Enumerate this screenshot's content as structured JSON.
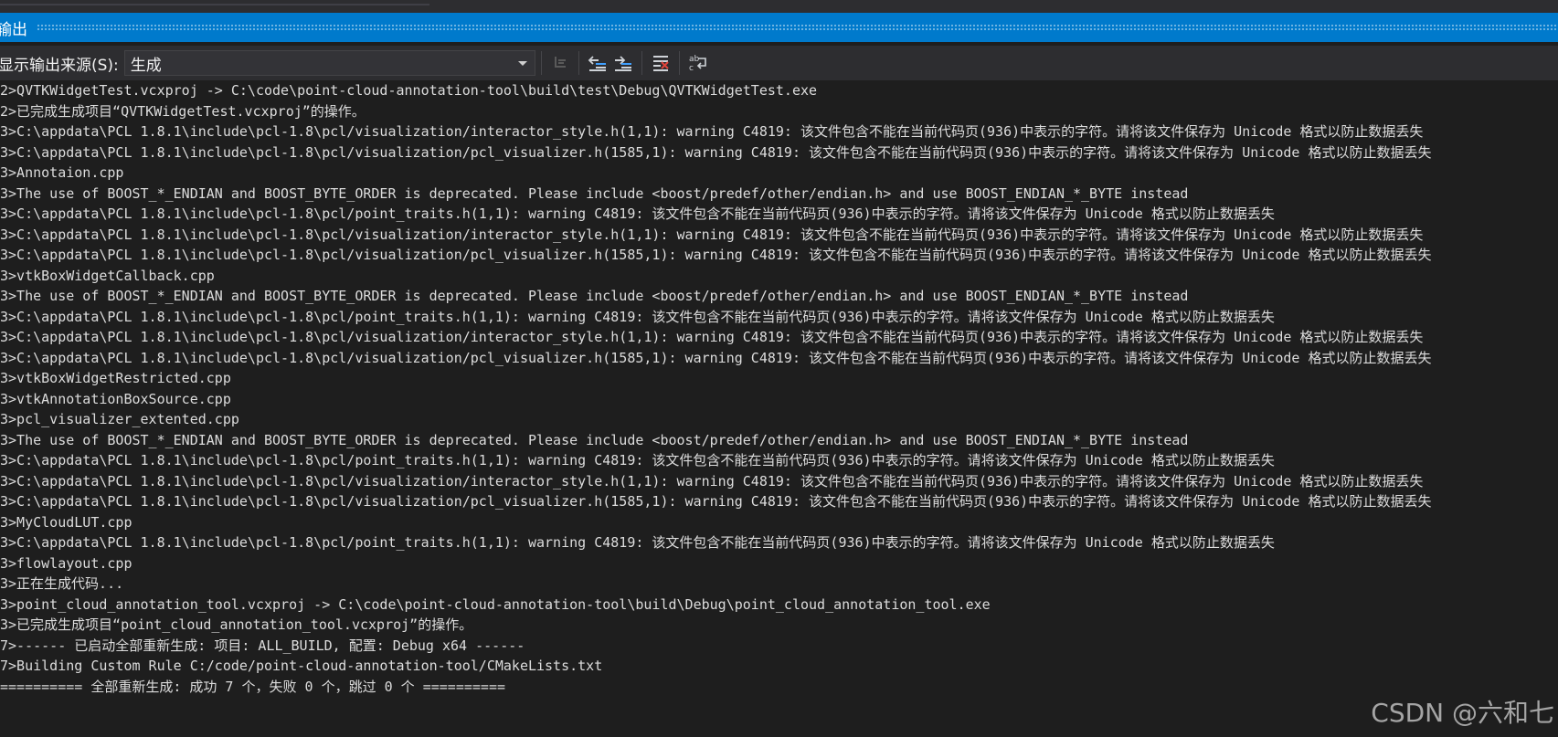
{
  "panel": {
    "title": "输出",
    "source_label": "显示输出来源(S):",
    "source_value": "生成"
  },
  "icons": {
    "find_message": "find-message-icon",
    "prev_message": "go-to-previous-message-icon",
    "next_message": "go-to-next-message-icon",
    "clear_all": "clear-all-icon",
    "word_wrap": "toggle-word-wrap-icon"
  },
  "colors": {
    "accent": "#007acc",
    "background": "#1e1e1e",
    "toolbar": "#2d2d30",
    "text": "#dcdcdc"
  },
  "output_lines": [
    "2>QVTKWidgetTest.vcxproj -> C:\\code\\point-cloud-annotation-tool\\build\\test\\Debug\\QVTKWidgetTest.exe",
    "2>已完成生成项目“QVTKWidgetTest.vcxproj”的操作。",
    "3>C:\\appdata\\PCL 1.8.1\\include\\pcl-1.8\\pcl/visualization/interactor_style.h(1,1): warning C4819: 该文件包含不能在当前代码页(936)中表示的字符。请将该文件保存为 Unicode 格式以防止数据丢失",
    "3>C:\\appdata\\PCL 1.8.1\\include\\pcl-1.8\\pcl/visualization/pcl_visualizer.h(1585,1): warning C4819: 该文件包含不能在当前代码页(936)中表示的字符。请将该文件保存为 Unicode 格式以防止数据丢失",
    "3>Annotaion.cpp",
    "3>The use of BOOST_*_ENDIAN and BOOST_BYTE_ORDER is deprecated. Please include <boost/predef/other/endian.h> and use BOOST_ENDIAN_*_BYTE instead",
    "3>C:\\appdata\\PCL 1.8.1\\include\\pcl-1.8\\pcl/point_traits.h(1,1): warning C4819: 该文件包含不能在当前代码页(936)中表示的字符。请将该文件保存为 Unicode 格式以防止数据丢失",
    "3>C:\\appdata\\PCL 1.8.1\\include\\pcl-1.8\\pcl/visualization/interactor_style.h(1,1): warning C4819: 该文件包含不能在当前代码页(936)中表示的字符。请将该文件保存为 Unicode 格式以防止数据丢失",
    "3>C:\\appdata\\PCL 1.8.1\\include\\pcl-1.8\\pcl/visualization/pcl_visualizer.h(1585,1): warning C4819: 该文件包含不能在当前代码页(936)中表示的字符。请将该文件保存为 Unicode 格式以防止数据丢失",
    "3>vtkBoxWidgetCallback.cpp",
    "3>The use of BOOST_*_ENDIAN and BOOST_BYTE_ORDER is deprecated. Please include <boost/predef/other/endian.h> and use BOOST_ENDIAN_*_BYTE instead",
    "3>C:\\appdata\\PCL 1.8.1\\include\\pcl-1.8\\pcl/point_traits.h(1,1): warning C4819: 该文件包含不能在当前代码页(936)中表示的字符。请将该文件保存为 Unicode 格式以防止数据丢失",
    "3>C:\\appdata\\PCL 1.8.1\\include\\pcl-1.8\\pcl/visualization/interactor_style.h(1,1): warning C4819: 该文件包含不能在当前代码页(936)中表示的字符。请将该文件保存为 Unicode 格式以防止数据丢失",
    "3>C:\\appdata\\PCL 1.8.1\\include\\pcl-1.8\\pcl/visualization/pcl_visualizer.h(1585,1): warning C4819: 该文件包含不能在当前代码页(936)中表示的字符。请将该文件保存为 Unicode 格式以防止数据丢失",
    "3>vtkBoxWidgetRestricted.cpp",
    "3>vtkAnnotationBoxSource.cpp",
    "3>pcl_visualizer_extented.cpp",
    "3>The use of BOOST_*_ENDIAN and BOOST_BYTE_ORDER is deprecated. Please include <boost/predef/other/endian.h> and use BOOST_ENDIAN_*_BYTE instead",
    "3>C:\\appdata\\PCL 1.8.1\\include\\pcl-1.8\\pcl/point_traits.h(1,1): warning C4819: 该文件包含不能在当前代码页(936)中表示的字符。请将该文件保存为 Unicode 格式以防止数据丢失",
    "3>C:\\appdata\\PCL 1.8.1\\include\\pcl-1.8\\pcl/visualization/interactor_style.h(1,1): warning C4819: 该文件包含不能在当前代码页(936)中表示的字符。请将该文件保存为 Unicode 格式以防止数据丢失",
    "3>C:\\appdata\\PCL 1.8.1\\include\\pcl-1.8\\pcl/visualization/pcl_visualizer.h(1585,1): warning C4819: 该文件包含不能在当前代码页(936)中表示的字符。请将该文件保存为 Unicode 格式以防止数据丢失",
    "3>MyCloudLUT.cpp",
    "3>C:\\appdata\\PCL 1.8.1\\include\\pcl-1.8\\pcl/point_traits.h(1,1): warning C4819: 该文件包含不能在当前代码页(936)中表示的字符。请将该文件保存为 Unicode 格式以防止数据丢失",
    "3>flowlayout.cpp",
    "3>正在生成代码...",
    "3>point_cloud_annotation_tool.vcxproj -> C:\\code\\point-cloud-annotation-tool\\build\\Debug\\point_cloud_annotation_tool.exe",
    "3>已完成生成项目“point_cloud_annotation_tool.vcxproj”的操作。",
    "7>------ 已启动全部重新生成: 项目: ALL_BUILD, 配置: Debug x64 ------",
    "7>Building Custom Rule C:/code/point-cloud-annotation-tool/CMakeLists.txt",
    "========== 全部重新生成: 成功 7 个，失败 0 个，跳过 0 个 =========="
  ],
  "watermark": "CSDN @六和七"
}
